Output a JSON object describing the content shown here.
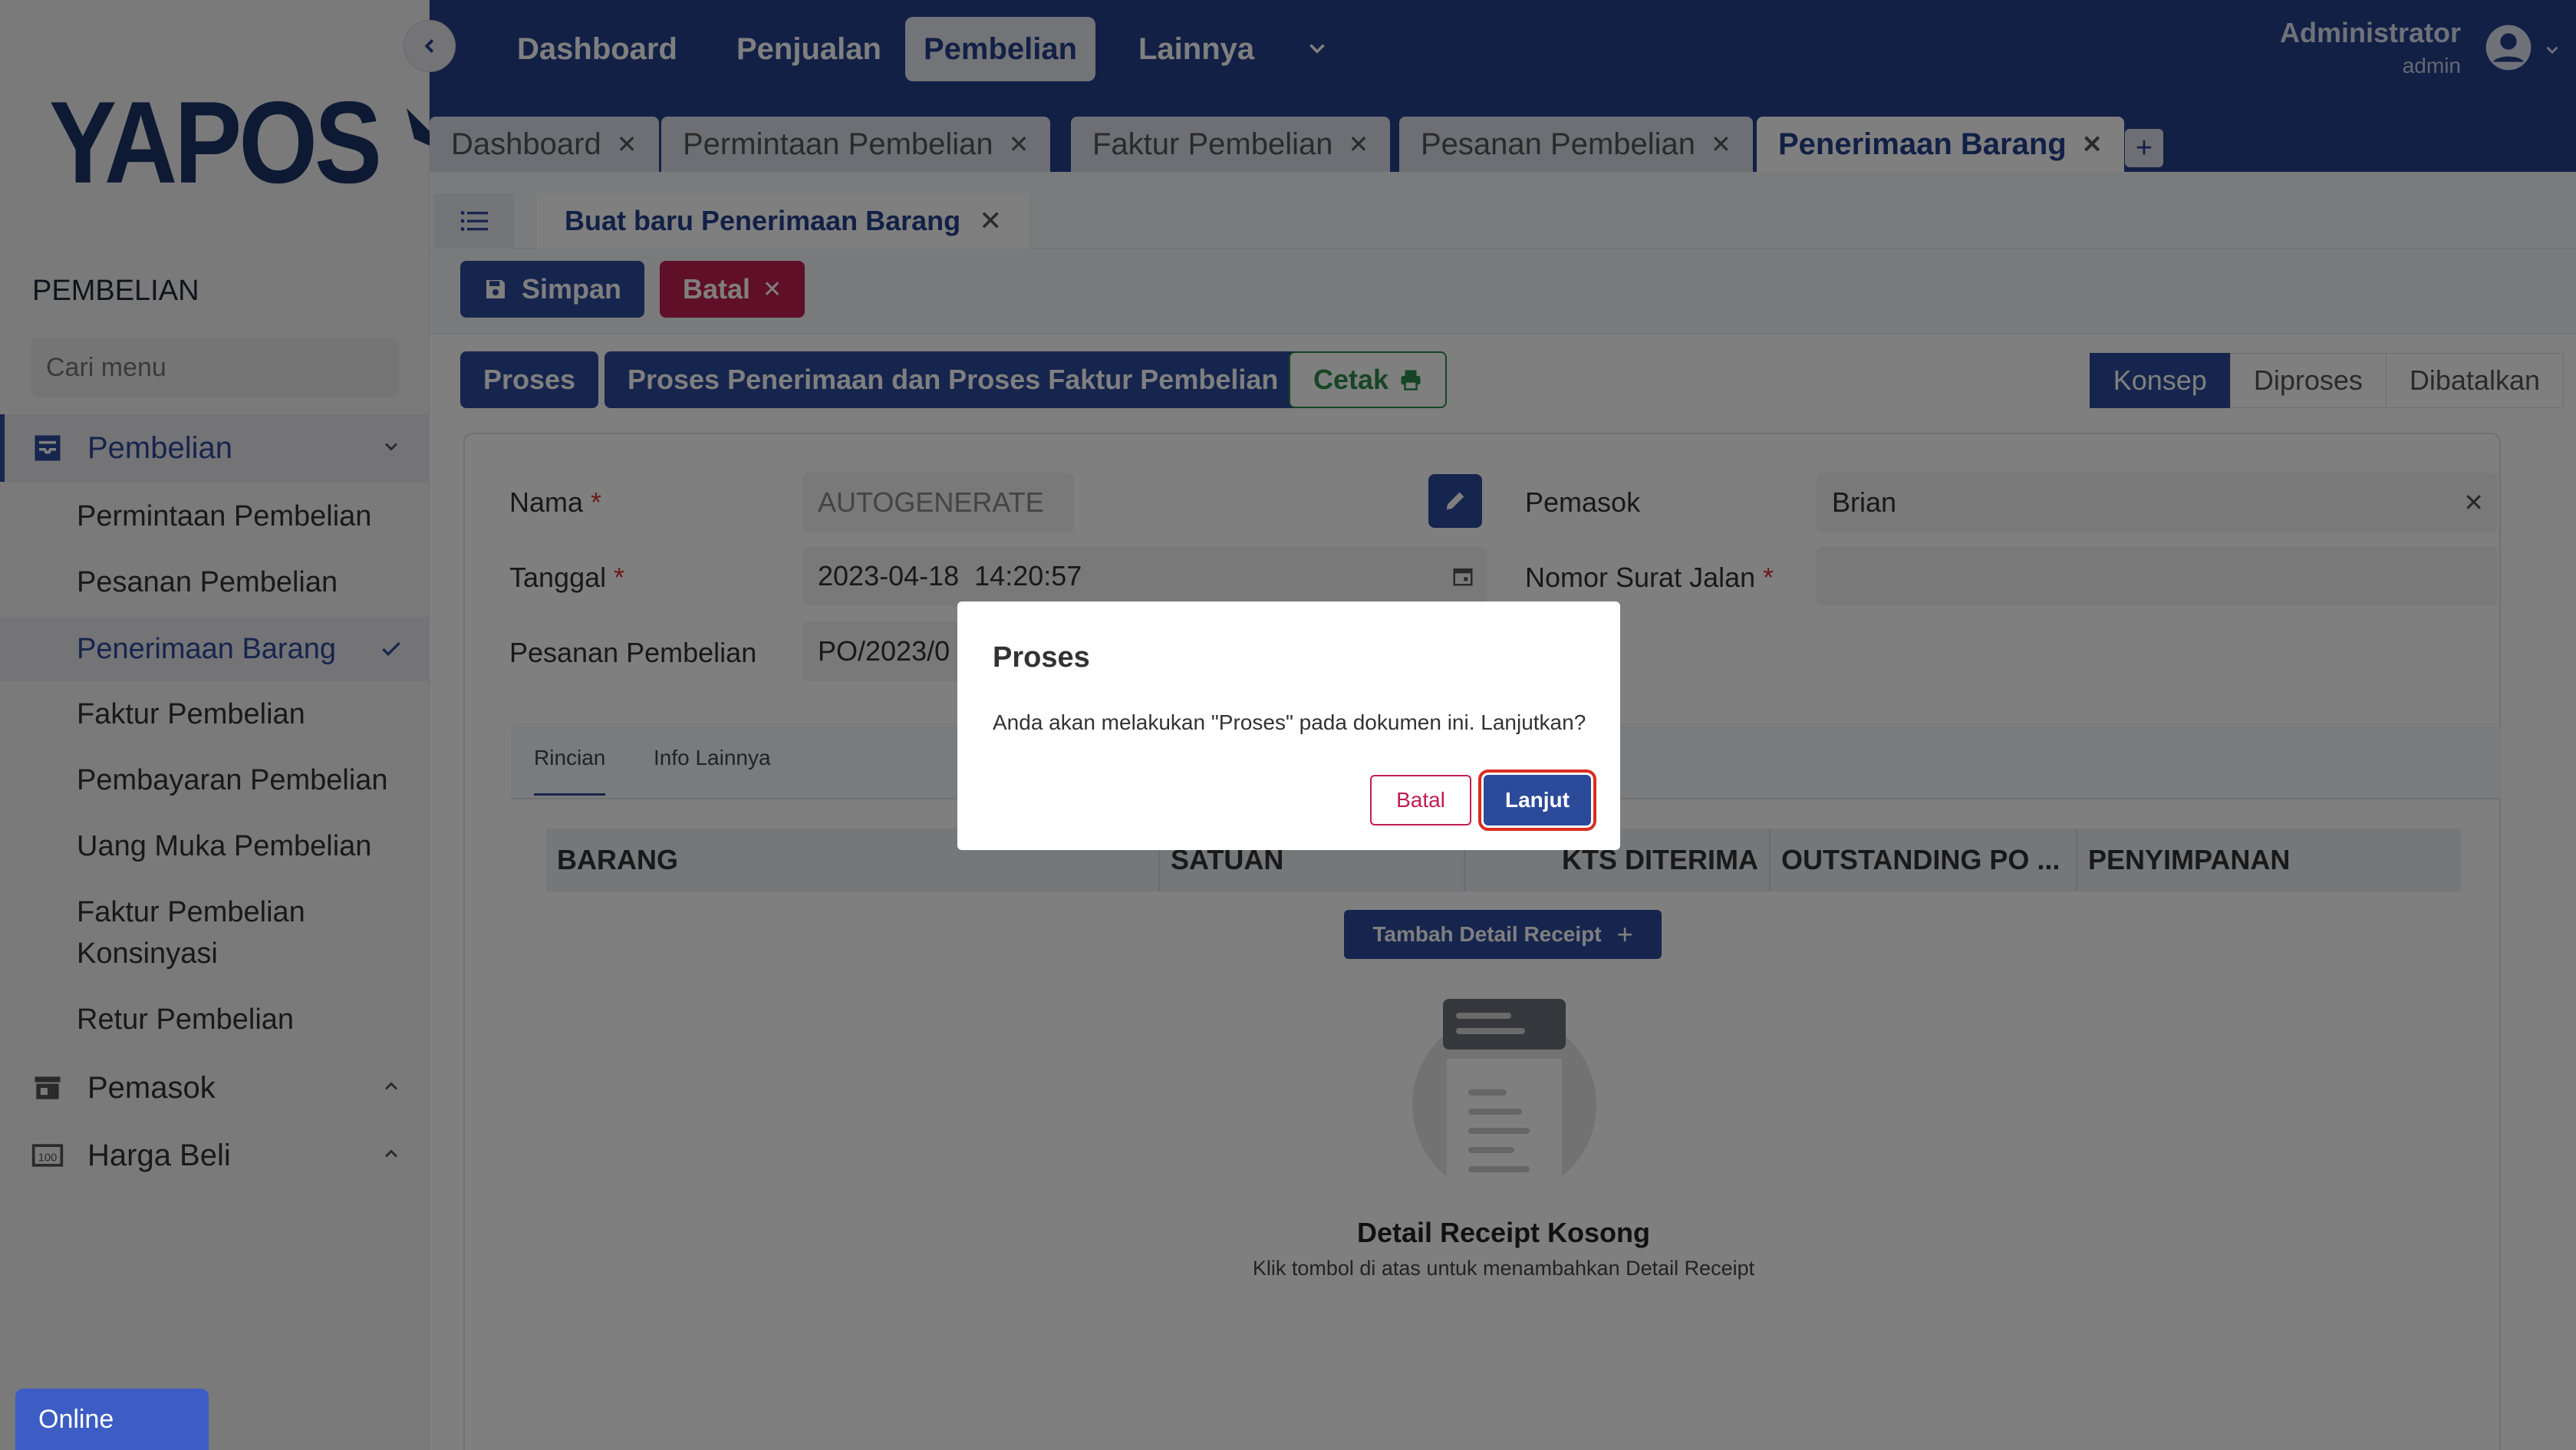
{
  "sidebar": {
    "logo_text": "YAPOS",
    "section_title": "PEMBELIAN",
    "search_placeholder": "Cari menu",
    "group_pembelian": "Pembelian",
    "items": [
      {
        "label": "Permintaan Pembelian"
      },
      {
        "label": "Pesanan Pembelian"
      },
      {
        "label": "Penerimaan Barang"
      },
      {
        "label": "Faktur Pembelian"
      },
      {
        "label": "Pembayaran Pembelian"
      },
      {
        "label": "Uang Muka Pembelian"
      },
      {
        "label": "Faktur Pembelian Konsinyasi"
      },
      {
        "label": "Retur Pembelian"
      }
    ],
    "group_pemasok": "Pemasok",
    "group_harga": "Harga Beli"
  },
  "topbar": {
    "nav": [
      "Dashboard",
      "Penjualan",
      "Pembelian",
      "Lainnya"
    ],
    "user_name": "Administrator",
    "user_role": "admin"
  },
  "doc_tabs": [
    "Dashboard",
    "Permintaan Pembelian",
    "Faktur Pembelian",
    "Pesanan Pembelian",
    "Penerimaan Barang"
  ],
  "subtab": "Buat baru Penerimaan Barang",
  "actions": {
    "simpan": "Simpan",
    "batal": "Batal",
    "proses": "Proses",
    "proses_faktur": "Proses Penerimaan dan Proses Faktur Pembelian",
    "cetak": "Cetak"
  },
  "status_steps": [
    "Konsep",
    "Diproses",
    "Dibatalkan"
  ],
  "form": {
    "nama_label": "Nama",
    "nama_value": "AUTOGENERATE",
    "tanggal_label": "Tanggal",
    "tanggal_value": "2023-04-18  14:20:57",
    "pesanan_label": "Pesanan Pembelian",
    "pesanan_value": "PO/2023/0",
    "pemasok_label": "Pemasok",
    "pemasok_value": "Brian",
    "surat_label": "Nomor Surat Jalan",
    "required_mark": "*"
  },
  "detail": {
    "tabs": [
      "Rincian",
      "Info Lainnya"
    ],
    "columns": [
      "BARANG",
      "SATUAN",
      "KTS DITERIMA",
      "OUTSTANDING PO ...",
      "PENYIMPANAN"
    ],
    "add_button": "Tambah Detail Receipt",
    "empty_title": "Detail Receipt Kosong",
    "empty_sub": "Klik tombol di atas untuk menambahkan Detail Receipt"
  },
  "modal": {
    "title": "Proses",
    "message": "Anda akan melakukan \"Proses\" pada dokumen ini. Lanjutkan?",
    "cancel": "Batal",
    "confirm": "Lanjut"
  },
  "status_badge": "Online",
  "colors": {
    "primary": "#24418d",
    "danger": "#c01e53",
    "success": "#2c8a4a"
  }
}
